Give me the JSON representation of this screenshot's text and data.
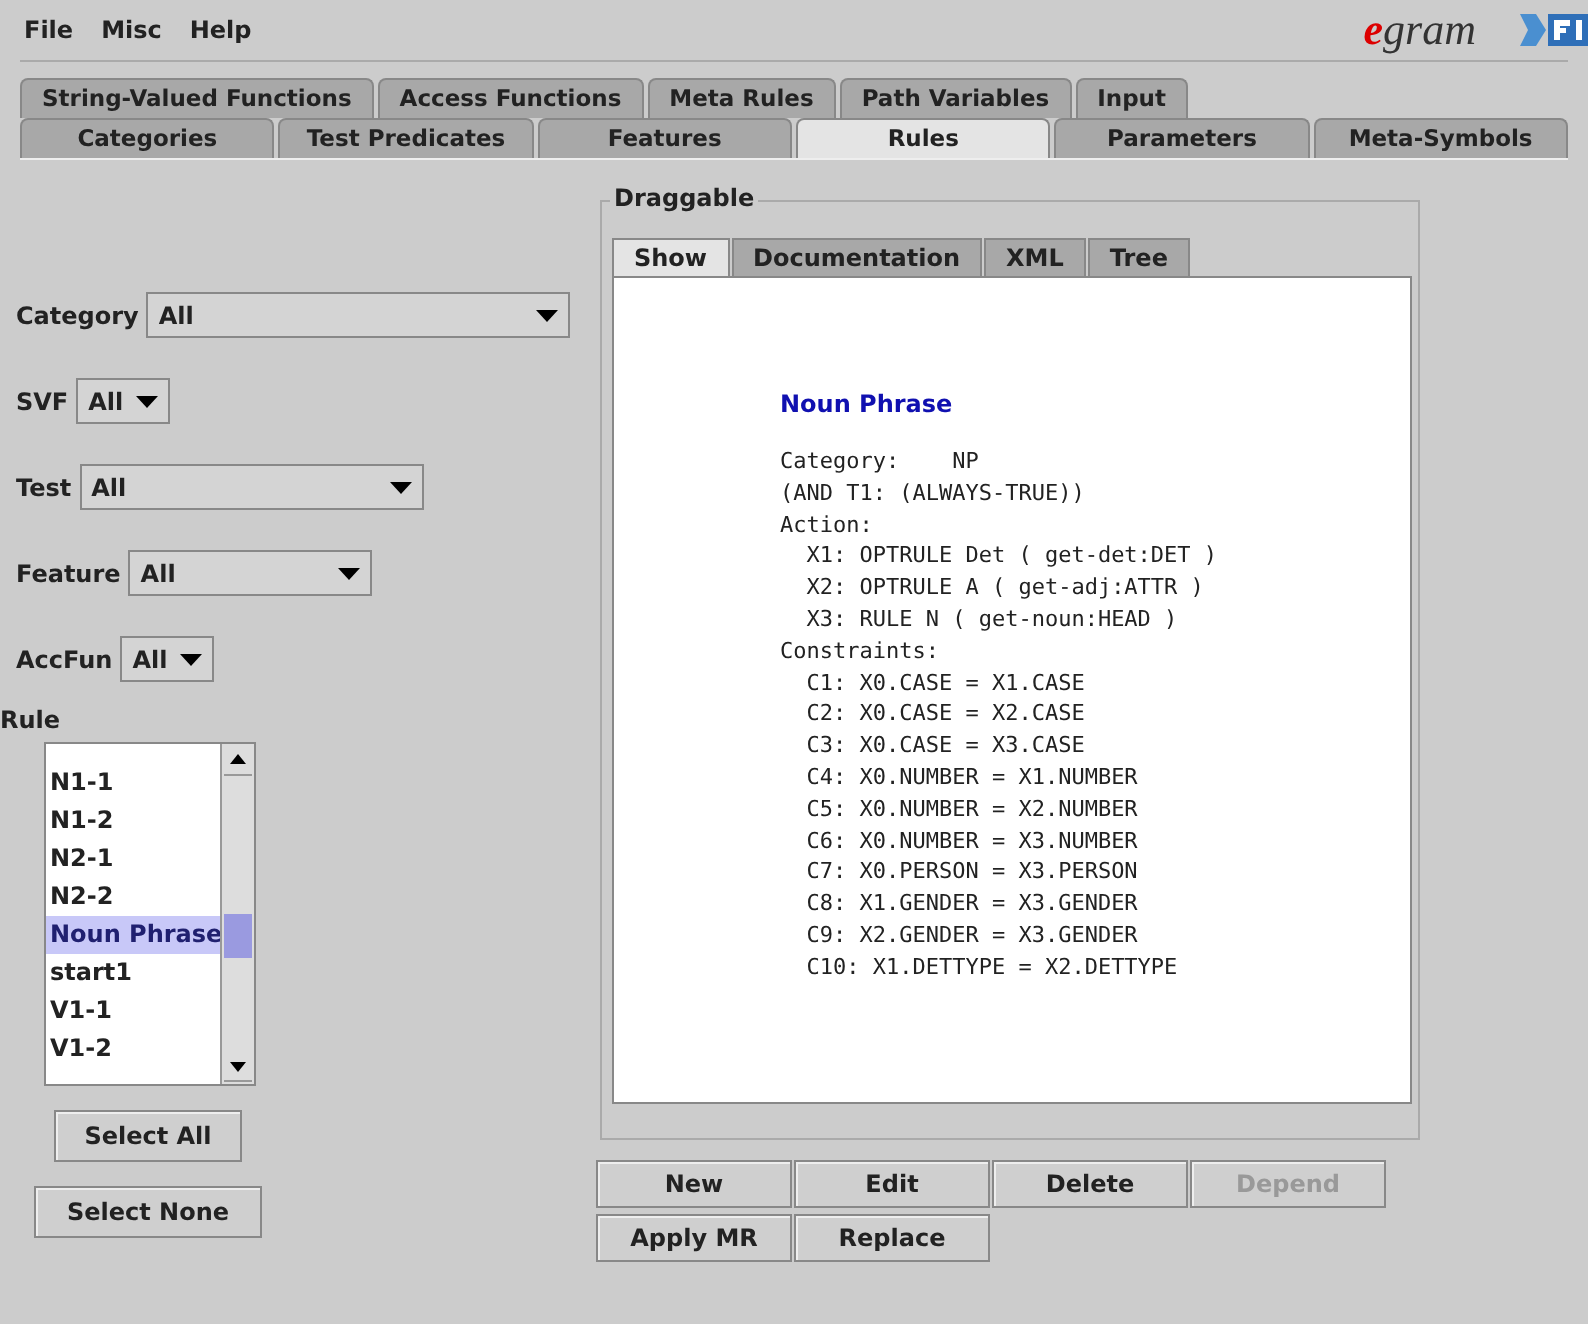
{
  "menu": [
    "File",
    "Misc",
    "Help"
  ],
  "logo": {
    "text": "egram"
  },
  "tabs_row1": [
    {
      "label": "String-Valued Functions",
      "selected": false
    },
    {
      "label": "Access Functions",
      "selected": false
    },
    {
      "label": "Meta Rules",
      "selected": false
    },
    {
      "label": "Path Variables",
      "selected": false
    },
    {
      "label": "Input",
      "selected": false
    }
  ],
  "tabs_row2": [
    {
      "label": "Categories",
      "selected": false
    },
    {
      "label": "Test Predicates",
      "selected": false
    },
    {
      "label": "Features",
      "selected": false
    },
    {
      "label": "Rules",
      "selected": true
    },
    {
      "label": "Parameters",
      "selected": false
    },
    {
      "label": "Meta-Symbols",
      "selected": false
    }
  ],
  "filters": [
    {
      "label": "Category",
      "value": "All"
    },
    {
      "label": "SVF",
      "value": "All"
    },
    {
      "label": "Test",
      "value": "All"
    },
    {
      "label": "Feature",
      "value": "All"
    },
    {
      "label": "AccFun",
      "value": "All"
    }
  ],
  "rule_list": {
    "label": "Rule",
    "items": [
      {
        "label": "N1-1",
        "selected": false
      },
      {
        "label": "N1-2",
        "selected": false
      },
      {
        "label": "N2-1",
        "selected": false
      },
      {
        "label": "N2-2",
        "selected": false
      },
      {
        "label": "Noun Phrase",
        "selected": true
      },
      {
        "label": "start1",
        "selected": false
      },
      {
        "label": "V1-1",
        "selected": false
      },
      {
        "label": "V1-2",
        "selected": false
      }
    ]
  },
  "list_buttons": [
    "Select All",
    "Select None"
  ],
  "panel": {
    "title": "Draggable",
    "tabs": [
      {
        "label": "Show",
        "selected": true
      },
      {
        "label": "Documentation",
        "selected": false
      },
      {
        "label": "XML",
        "selected": false
      },
      {
        "label": "Tree",
        "selected": false
      }
    ],
    "heading": "Noun Phrase",
    "lines": [
      "Category:    NP",
      "(AND T1: (ALWAYS-TRUE))",
      "Action:",
      "  X1: OPTRULE Det ( get-det:DET )",
      "  X2: OPTRULE A ( get-adj:ATTR )",
      "  X3: RULE N ( get-noun:HEAD )",
      "Constraints:",
      "  C1: X0.CASE = X1.CASE",
      "  C2: X0.CASE = X2.CASE",
      "  C3: X0.CASE = X3.CASE",
      "  C4: X0.NUMBER = X1.NUMBER",
      "  C5: X0.NUMBER = X2.NUMBER",
      "  C6: X0.NUMBER = X3.NUMBER",
      "  C7: X0.PERSON = X3.PERSON",
      "  C8: X1.GENDER = X3.GENDER",
      "  C9: X2.GENDER = X3.GENDER",
      "  C10: X1.DETTYPE = X2.DETTYPE"
    ]
  },
  "actions": [
    {
      "label": "New",
      "disabled": false
    },
    {
      "label": "Edit",
      "disabled": false
    },
    {
      "label": "Delete",
      "disabled": false
    },
    {
      "label": "Depend",
      "disabled": true
    },
    {
      "label": "Apply MR",
      "disabled": false
    },
    {
      "label": "Replace",
      "disabled": false
    }
  ]
}
